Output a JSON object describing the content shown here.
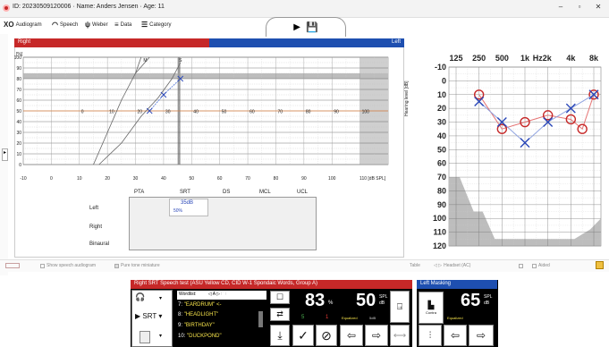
{
  "window": {
    "title": "ID: 20230509120006  ·  Name: Anders Jensen  ·  Age: 11"
  },
  "toolbar": {
    "items": [
      "Audiogram",
      "Speech",
      "Weber",
      "Data",
      "Category"
    ]
  },
  "speech": {
    "right_label": "Right",
    "left_label": "Left",
    "y_unit": "[%]",
    "y_ticks": [
      "100",
      "90",
      "80",
      "70",
      "60",
      "50",
      "40",
      "30",
      "20",
      "10",
      "0"
    ],
    "x_ticks": [
      "-10",
      "0",
      "10",
      "20",
      "30",
      "40",
      "50",
      "60",
      "70",
      "80",
      "90",
      "100",
      "110 [dB SPL]"
    ],
    "inner_ticks": [
      "0",
      "10",
      "20",
      "30",
      "40",
      "50",
      "60",
      "70",
      "80",
      "90",
      "100"
    ],
    "curve_labels": [
      "M",
      "S"
    ],
    "points": [
      {
        "x": 35,
        "y": 50
      },
      {
        "x": 40,
        "y": 65
      },
      {
        "x": 46,
        "y": 80
      }
    ],
    "table": {
      "headers": [
        "PTA",
        "SRT",
        "DS",
        "MCL",
        "UCL"
      ],
      "rows": [
        "Left",
        "Right",
        "Binaural"
      ],
      "srt_left_value": "35dB",
      "srt_left_percent": "50%"
    }
  },
  "audiogram": {
    "freq_labels": [
      "125",
      "250",
      "500",
      "1k",
      "Hz2k",
      "4k",
      "8k"
    ],
    "y_labels": [
      "-10",
      "0",
      "10",
      "20",
      "30",
      "40",
      "50",
      "60",
      "70",
      "80",
      "90",
      "100",
      "110",
      "120"
    ],
    "y_axis_title": "Hearing level [dB]",
    "right_ear_thresholds": [
      {
        "f": "250",
        "db": 10
      },
      {
        "f": "500",
        "db": 35
      },
      {
        "f": "1k",
        "db": 30
      },
      {
        "f": "2k",
        "db": 25
      },
      {
        "f": "4k",
        "db": 28
      },
      {
        "f": "6k",
        "db": 35
      },
      {
        "f": "8k",
        "db": 10
      }
    ],
    "left_ear_thresholds": [
      {
        "f": "250",
        "db": 15
      },
      {
        "f": "500",
        "db": 30
      },
      {
        "f": "1k",
        "db": 45
      },
      {
        "f": "2k",
        "db": 30
      },
      {
        "f": "4k",
        "db": 20
      },
      {
        "f": "8k",
        "db": 10
      }
    ]
  },
  "bottom_bar": {
    "show_speech_audiogram": "Show speech audiogram",
    "pure_tone_miniature": "Pure tone miniature",
    "table": "Table",
    "headset": "Headset (AC)",
    "aided": "Aided"
  },
  "control": {
    "header": "Right SRT  Speech test (ASU Yellow CD, CID W-1 Spondaic Words, Group A)",
    "test_select": "SRT",
    "wordlist_label": "Wordlist:",
    "wordlist_letter": "A",
    "words": [
      {
        "n": "7:",
        "w": "\"EARDRUM\" <-"
      },
      {
        "n": "8:",
        "w": "\"HEADLIGHT\""
      },
      {
        "n": "9:",
        "w": "\"BIRTHDAY\""
      },
      {
        "n": "10:",
        "w": "\"DUCKPOND\""
      }
    ],
    "score_value": "83",
    "score_unit": "%",
    "score_correct": "5",
    "score_wrong": "1",
    "level_value": "50",
    "level_unit_top": "SPL",
    "level_unit_bottom": "dB",
    "level_mode": "Equalized",
    "level_step": "5dB"
  },
  "masking": {
    "header": "Left Masking",
    "contra": "Contra",
    "mode": "Equalized",
    "value": "65",
    "unit_top": "SPL",
    "unit_bottom": "dB"
  }
}
